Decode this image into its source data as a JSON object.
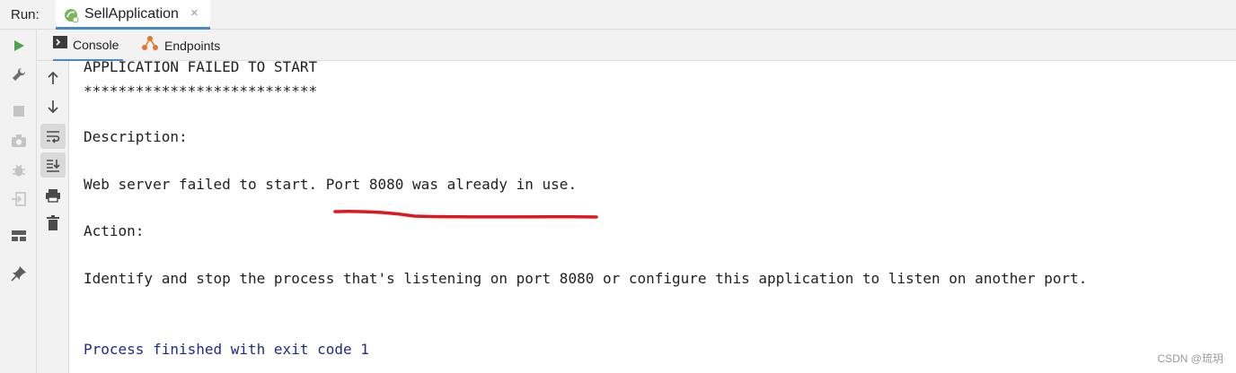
{
  "run_bar": {
    "label": "Run:",
    "tab_title": "SellApplication",
    "close_glyph": "×"
  },
  "left_toolbar": {
    "icons": [
      "run-icon",
      "wrench-icon",
      "stop-icon",
      "camera-icon",
      "debug-bug-icon",
      "exit-icon",
      "layout-icon",
      "pin-icon"
    ]
  },
  "sub_tabs": {
    "console_label": "Console",
    "endpoints_label": "Endpoints"
  },
  "console_tools": {
    "icons": [
      "arrow-up-icon",
      "arrow-down-icon",
      "soft-wrap-icon",
      "scroll-to-end-icon",
      "print-icon",
      "trash-icon"
    ]
  },
  "console": {
    "lines": [
      "APPLICATION FAILED TO START",
      "***************************",
      "Description:",
      "Web server failed to start. Port 8080 was already in use.",
      "Action:",
      "Identify and stop the process that's listening on port 8080 or configure this application to listen on another port.",
      "Process finished with exit code 1"
    ]
  },
  "watermark": "CSDN @琉玥",
  "colors": {
    "accent": "#4a88c7",
    "run_green": "#4fa34f",
    "exit_text": "#1f2a8c",
    "annotation_red": "#e0161a",
    "endpoints_orange": "#e0772c"
  }
}
